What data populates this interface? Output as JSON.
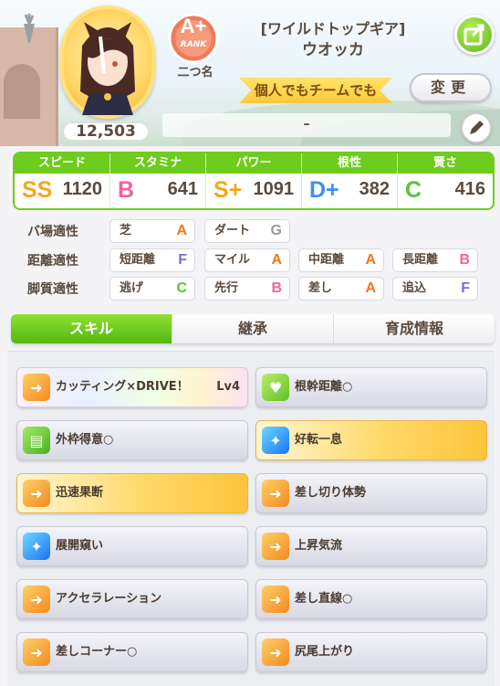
{
  "header": {
    "trainer_title": "[ワイルドトップギア]",
    "horse_name": "ウオッカ",
    "rank_label": "RANK",
    "rank_grade": "A+",
    "nickname": "二つ名",
    "fan_count": "12,503",
    "slogan": "個人でもチームでも",
    "change_button": "変更",
    "motto": "–"
  },
  "stats": [
    {
      "label": "スピード",
      "grade": "SS",
      "value": "1120",
      "color": "#f2a81c"
    },
    {
      "label": "スタミナ",
      "grade": "B",
      "value": "641",
      "color": "#f062a4"
    },
    {
      "label": "パワー",
      "grade": "S+",
      "value": "1091",
      "color": "#f2a81c"
    },
    {
      "label": "根性",
      "grade": "D+",
      "value": "382",
      "color": "#3d8ff2"
    },
    {
      "label": "賢さ",
      "grade": "C",
      "value": "416",
      "color": "#5cc234"
    }
  ],
  "aptitude": {
    "track": {
      "label": "バ場適性",
      "items": [
        {
          "name": "芝",
          "grade": "A"
        },
        {
          "name": "ダート",
          "grade": "G"
        }
      ]
    },
    "distance": {
      "label": "距離適性",
      "items": [
        {
          "name": "短距離",
          "grade": "F"
        },
        {
          "name": "マイル",
          "grade": "A"
        },
        {
          "name": "中距離",
          "grade": "A"
        },
        {
          "name": "長距離",
          "grade": "B"
        }
      ]
    },
    "style": {
      "label": "脚質適性",
      "items": [
        {
          "name": "逃げ",
          "grade": "C"
        },
        {
          "name": "先行",
          "grade": "B"
        },
        {
          "name": "差し",
          "grade": "A"
        },
        {
          "name": "追込",
          "grade": "F"
        }
      ]
    }
  },
  "grade_colors": {
    "A": "#f5751b",
    "B": "#f062a4",
    "C": "#5cc234",
    "F": "#7b6bd8",
    "G": "#9a9a9a"
  },
  "tabs": [
    "スキル",
    "継承",
    "育成情報"
  ],
  "skills": [
    {
      "name": "カッティング×DRIVE！",
      "level": "Lv4",
      "style": "rainbow",
      "icon": "speed-boost-icon"
    },
    {
      "name": "根幹距離○",
      "level": "",
      "style": "normal",
      "icon": "heart-icon"
    },
    {
      "name": "外枠得意○",
      "level": "",
      "style": "normal",
      "icon": "gate-icon"
    },
    {
      "name": "好転一息",
      "level": "",
      "style": "gold",
      "icon": "sparkle-icon"
    },
    {
      "name": "迅速果断",
      "level": "",
      "style": "gold",
      "icon": "speed-boost-icon"
    },
    {
      "name": "差し切り体勢",
      "level": "",
      "style": "normal",
      "icon": "speed-boost-icon"
    },
    {
      "name": "展開窺い",
      "level": "",
      "style": "normal",
      "icon": "sparkle-icon"
    },
    {
      "name": "上昇気流",
      "level": "",
      "style": "normal",
      "icon": "speed-boost-icon"
    },
    {
      "name": "アクセラレーション",
      "level": "",
      "style": "normal",
      "icon": "speed-boost-icon"
    },
    {
      "name": "差し直線○",
      "level": "",
      "style": "normal",
      "icon": "speed-boost-icon"
    },
    {
      "name": "差しコーナー○",
      "level": "",
      "style": "normal",
      "icon": "speed-boost-icon"
    },
    {
      "name": "尻尾上がり",
      "level": "",
      "style": "normal",
      "icon": "speed-boost-icon"
    }
  ]
}
